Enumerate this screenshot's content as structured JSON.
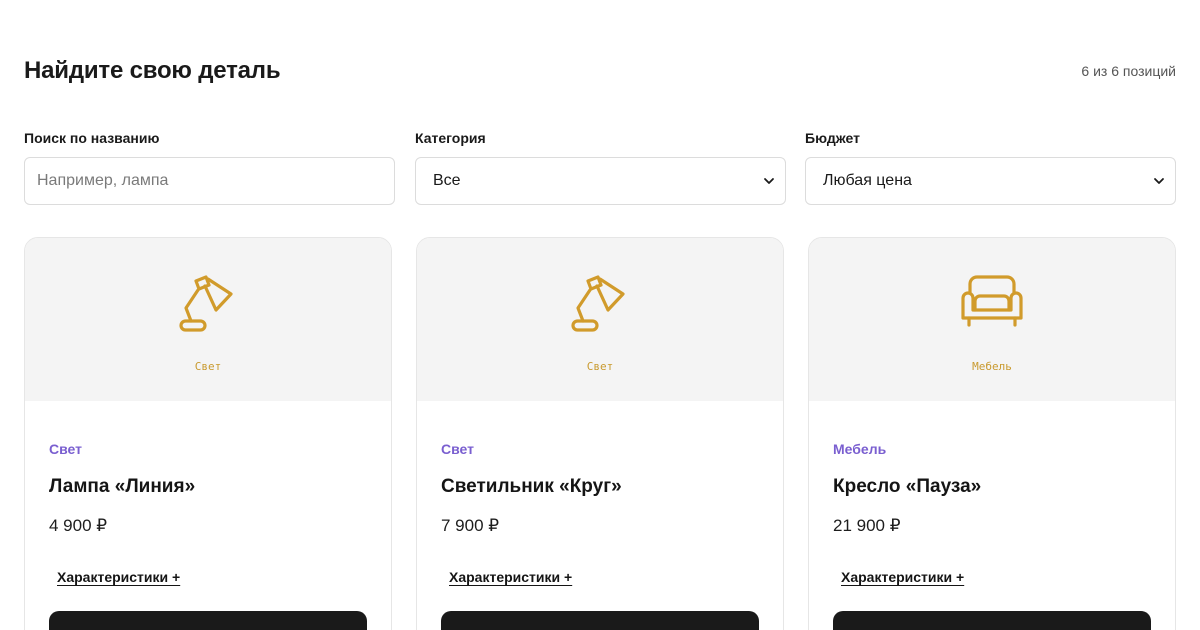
{
  "header": {
    "title": "Найдите свою деталь",
    "count": "6 из 6 позиций"
  },
  "filters": {
    "search": {
      "label": "Поиск по названию",
      "placeholder": "Например, лампа",
      "value": ""
    },
    "category": {
      "label": "Категория",
      "selected": "Все"
    },
    "budget": {
      "label": "Бюджет",
      "selected": "Любая цена"
    }
  },
  "colors": {
    "accent_icon": "#d19b2b",
    "category_text": "#7a5fd0",
    "media_bg": "#f4f4f4",
    "button_bg": "#1a1a1a"
  },
  "products": [
    {
      "icon": "desk-lamp-icon",
      "media_tag": "Свет",
      "category": "Свет",
      "name": "Лампа «Линия»",
      "price": "4 900 ₽",
      "specs_label": "Характеристики +"
    },
    {
      "icon": "desk-lamp-icon",
      "media_tag": "Свет",
      "category": "Свет",
      "name": "Светильник «Круг»",
      "price": "7 900 ₽",
      "specs_label": "Характеристики +"
    },
    {
      "icon": "armchair-icon",
      "media_tag": "Мебель",
      "category": "Мебель",
      "name": "Кресло «Пауза»",
      "price": "21 900 ₽",
      "specs_label": "Характеристики +"
    }
  ]
}
